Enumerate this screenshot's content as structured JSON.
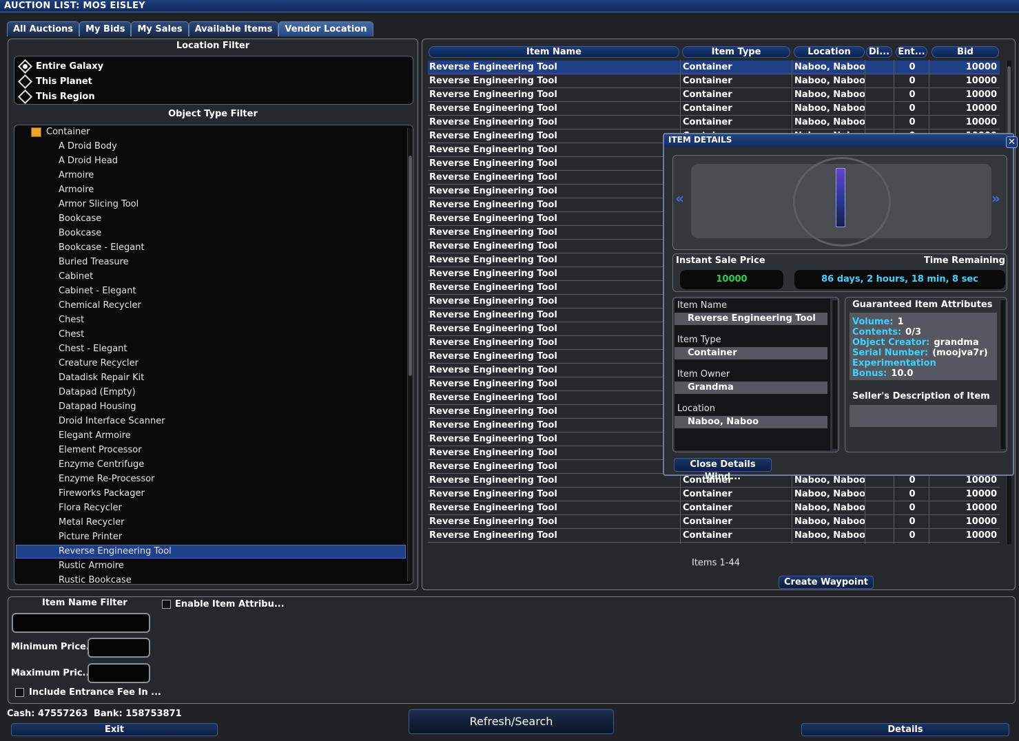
{
  "window": {
    "title": "AUCTION LIST: MOS EISLEY"
  },
  "tabs": [
    "All Auctions",
    "My Bids",
    "My Sales",
    "Available Items",
    "Vendor Location"
  ],
  "location_filter": {
    "title": "Location Filter",
    "options": [
      "Entire Galaxy",
      "This Planet",
      "This Region"
    ],
    "selected": "Entire Galaxy"
  },
  "object_filter": {
    "title": "Object Type Filter",
    "category": "Container",
    "items": [
      "A Droid Body",
      "A Droid Head",
      "Armoire",
      "Armoire",
      "Armor Slicing Tool",
      "Bookcase",
      "Bookcase",
      "Bookcase - Elegant",
      "Buried Treasure",
      "Cabinet",
      "Cabinet - Elegant",
      "Chemical Recycler",
      "Chest",
      "Chest",
      "Chest - Elegant",
      "Creature Recycler",
      "Datadisk Repair Kit",
      "Datapad (Empty)",
      "Datapad Housing",
      "Droid Interface Scanner",
      "Elegant Armoire",
      "Element Processor",
      "Enzyme Centrifuge",
      "Enzyme Re-Processor",
      "Fireworks Packager",
      "Flora Recycler",
      "Metal Recycler",
      "Picture Printer",
      "Reverse Engineering Tool",
      "Rustic Armoire",
      "Rustic Bookcase"
    ],
    "selected_index": 28
  },
  "table": {
    "columns": [
      "Item Name",
      "Item Type",
      "Location",
      "Di...",
      "Ent...",
      "Bid"
    ],
    "row": {
      "name": "Reverse Engineering Tool",
      "type": "Container",
      "location": "Naboo, Naboo",
      "di": "",
      "ent": "0",
      "bid": "10000"
    },
    "row_count": 35,
    "selected_row": 0,
    "footer": "Items 1-44"
  },
  "create_waypoint": "Create Waypoint",
  "details": {
    "title": "ITEM DETAILS",
    "instant_label": "Instant Sale Price",
    "time_label": "Time Remaining",
    "instant_value": "10000",
    "time_value": "86 days, 2 hours, 18 min, 8 sec",
    "fields": [
      {
        "label": "Item Name",
        "value": "Reverse Engineering Tool"
      },
      {
        "label": "Item Type",
        "value": "Container"
      },
      {
        "label": "Item Owner",
        "value": "Grandma"
      },
      {
        "label": "Location",
        "value": "Naboo, Naboo"
      }
    ],
    "attributes_title": "Guaranteed Item Attributes",
    "attributes": [
      {
        "k": "Volume:",
        "v": "1"
      },
      {
        "k": "Contents:",
        "v": "0/3"
      },
      {
        "k": "Object Creator:",
        "v": "grandma"
      },
      {
        "k": "Serial Number:",
        "v": "(moojva7r)"
      },
      {
        "k": "Experimentation Bonus:",
        "v": "10.0"
      }
    ],
    "seller_desc_title": "Seller's Description of Item",
    "close_button": "Close Details Wind..."
  },
  "bottom": {
    "item_name_filter": "Item Name Filter",
    "enable_attr": "Enable Item Attribu...",
    "min_price": "Minimum Price...",
    "max_price": "Maximum Pric...",
    "include_fee": "Include Entrance Fee In ...",
    "cash_label": "Cash:",
    "cash": "47557263",
    "bank_label": "Bank:",
    "bank": "158753871",
    "exit": "Exit",
    "refresh": "Refresh/Search",
    "details": "Details"
  },
  "colors": {
    "accent": "#1f3f86",
    "green": "#23d34a",
    "cyan": "#3fd1ff"
  }
}
